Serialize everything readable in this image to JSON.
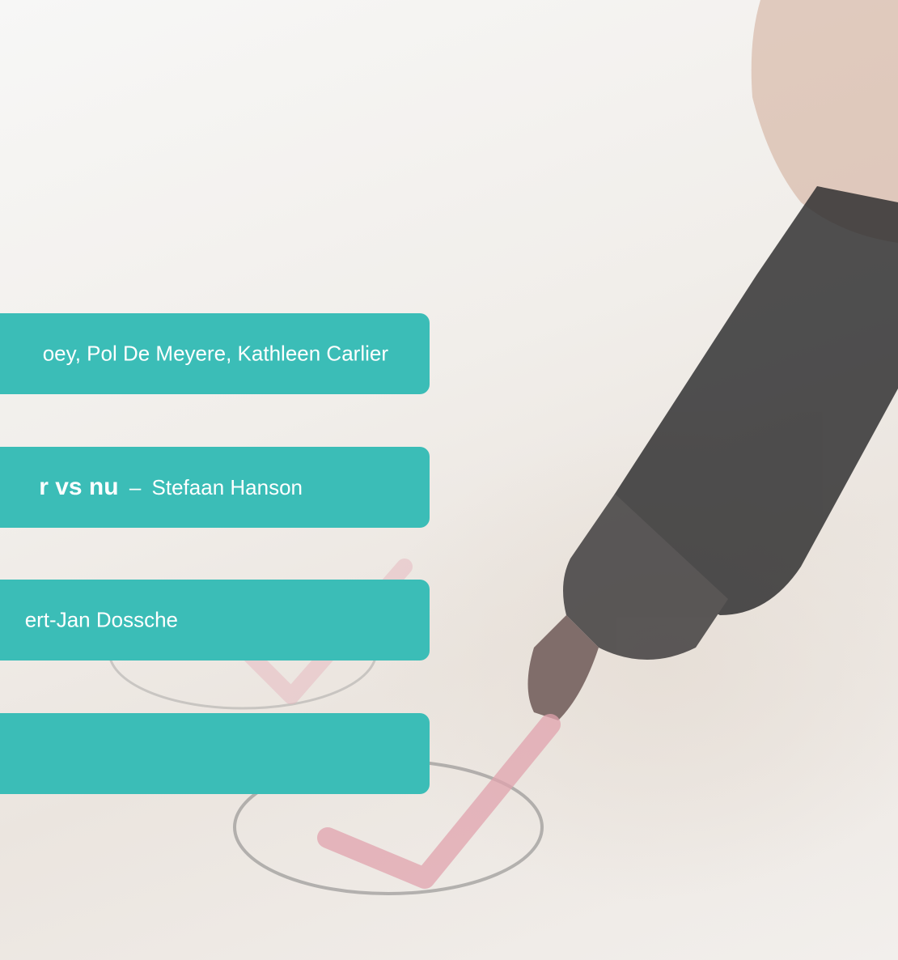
{
  "sessions": [
    {
      "title": "",
      "separator": "",
      "speakers": "oey, Pol De Meyere, Kathleen Carlier"
    },
    {
      "title": "r vs nu",
      "separator": "–",
      "speakers": "Stefaan Hanson"
    },
    {
      "title": "",
      "separator": "",
      "speakers": "ert-Jan Dossche"
    },
    {
      "title": "",
      "separator": "",
      "speakers": ""
    }
  ],
  "colors": {
    "accent": "#3bbdb7",
    "text": "#ffffff",
    "background": "#f3f1ee"
  }
}
